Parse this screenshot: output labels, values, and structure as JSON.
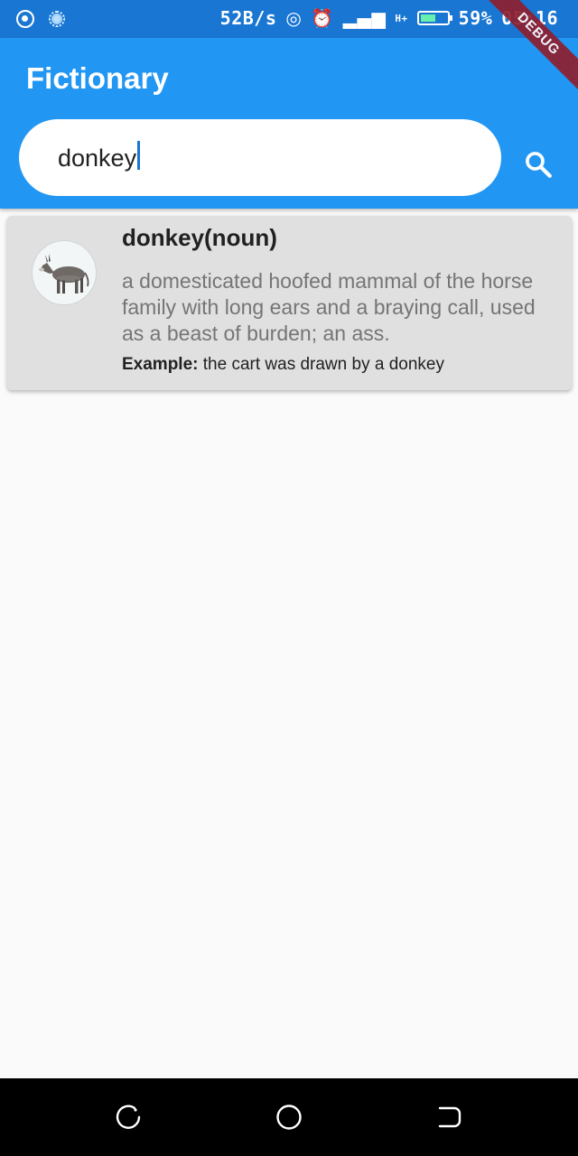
{
  "status_bar": {
    "net_speed": "52B/s",
    "signal_label": "H+",
    "battery": "59%",
    "battery_level": 0.59,
    "time": "05:16"
  },
  "debug_banner": "DEBUG",
  "app_bar": {
    "title": "Fictionary",
    "search": {
      "value": "donkey",
      "icon": "search-icon"
    }
  },
  "results": [
    {
      "word": "donkey(noun)",
      "definition": "a domesticated hoofed mammal of the horse family with long ears and a braying call, used as a beast of burden; an ass.",
      "example_label": "Example:",
      "example_text": " the cart was drawn by a donkey",
      "image": "donkey-image"
    }
  ],
  "nav_bar": {
    "icons": [
      "recent-apps-icon",
      "home-icon",
      "back-icon"
    ]
  },
  "colors": {
    "primary": "#2196f3",
    "status_bar": "#1976d2",
    "card": "#e0e0e0",
    "background": "#fafafa"
  }
}
